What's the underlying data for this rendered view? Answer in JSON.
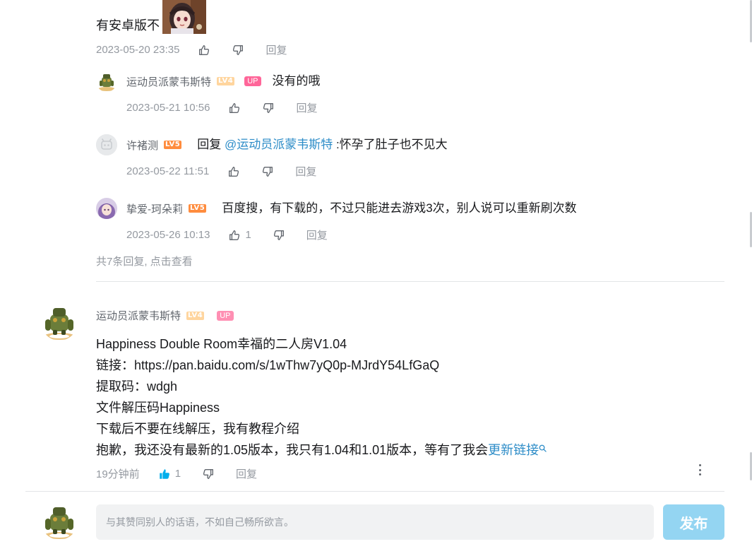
{
  "thread": {
    "root_tail": {
      "text": "有安卓版不",
      "time": "2023-05-20 23:35",
      "reply_label": "回复"
    },
    "replies": [
      {
        "user": "运动员派蒙韦斯特",
        "level": "LV4",
        "up_badge": "UP",
        "prefix": "",
        "at": "",
        "text": "没有的哦",
        "time": "2023-05-21 10:56",
        "likes": "",
        "reply_label": "回复"
      },
      {
        "user": "许褚测",
        "level": "LV5",
        "up_badge": "",
        "prefix": "回复 ",
        "at": "@运动员派蒙韦斯特",
        "text": " :怀孕了肚子也不见大",
        "time": "2023-05-22 11:51",
        "likes": "",
        "reply_label": "回复"
      },
      {
        "user": "挚爱-珂朵莉",
        "level": "LV5",
        "up_badge": "",
        "prefix": "",
        "at": "",
        "text": "百度搜，有下载的，不过只能进去游戏3次，别人说可以重新刷次数",
        "time": "2023-05-26 10:13",
        "likes": "1",
        "reply_label": "回复"
      }
    ],
    "more_replies": "共7条回复, 点击查看"
  },
  "comment": {
    "user": "运动员派蒙韦斯特",
    "level": "LV4",
    "up_badge": "UP",
    "lines": [
      "Happiness Double Room幸福的二人房V1.04",
      "链接：https://pan.baidu.com/s/1wThw7yQ0p-MJrdY54LfGaQ",
      "提取码：wdgh",
      "文件解压码Happiness",
      "下载后不要在线解压，我有教程介绍"
    ],
    "last_line_text": "抱歉，我还没有最新的1.05版本，我只有1.04和1.01版本，等有了我会",
    "last_line_link": "更新链接",
    "time": "19分钟前",
    "likes": "1",
    "reply_label": "回复"
  },
  "composer": {
    "placeholder": "与其赞同别人的话语，不如自己畅所欲言。",
    "send_label": "发布"
  },
  "colors": {
    "accent_link": "#2e8dc8",
    "send_button": "#94d5f2",
    "up_badge": "#ff6699",
    "level5": "#ff8c3e",
    "level4": "#ffd59e",
    "like_active": "#00aeec"
  }
}
